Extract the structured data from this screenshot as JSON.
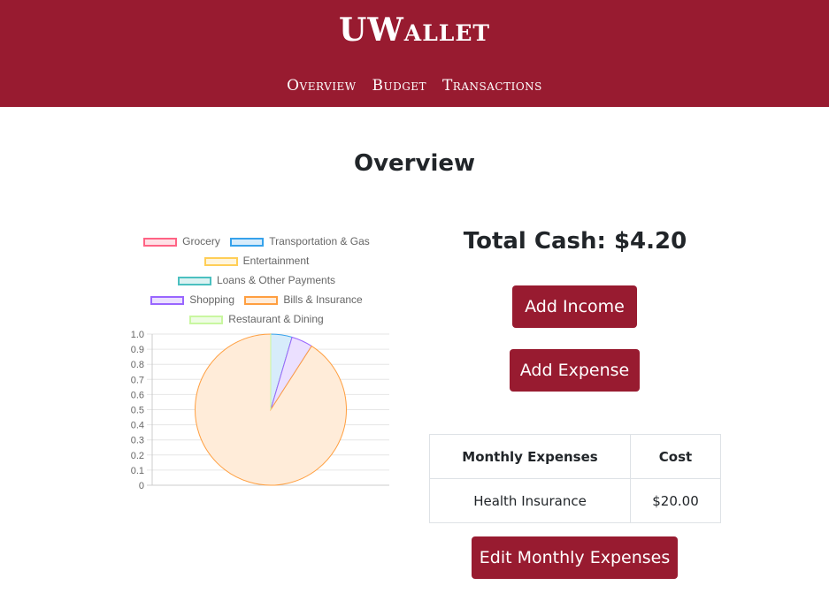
{
  "app": {
    "brand": "UWallet",
    "nav": [
      "Overview",
      "Budget",
      "Transactions"
    ]
  },
  "page": {
    "title": "Overview"
  },
  "chart_data": {
    "type": "pie",
    "legend_position": "top",
    "categories": [
      "Grocery",
      "Transportation & Gas",
      "Entertainment",
      "Loans & Other Payments",
      "Shopping",
      "Bills & Insurance",
      "Restaurant & Dining"
    ],
    "values": [
      0,
      1,
      0,
      0,
      1,
      20,
      0
    ],
    "colors": [
      "#ff6384",
      "#36a2eb",
      "#ffce56",
      "#4bc0c0",
      "#9966ff",
      "#ff9f40",
      "#c9f7a0"
    ],
    "fill_colors": [
      "#ffe0e6",
      "#d7ecfb",
      "#fff5dd",
      "#dbf2f2",
      "#ebe0ff",
      "#ffecd9",
      "#eefce3"
    ],
    "yticks": [
      "0",
      "0.1",
      "0.2",
      "0.3",
      "0.4",
      "0.5",
      "0.6",
      "0.7",
      "0.8",
      "0.9",
      "1.0"
    ],
    "ylim": [
      0,
      1.0
    ],
    "grid": true
  },
  "summary": {
    "total_cash": "Total Cash: $4.20",
    "add_income": "Add Income",
    "add_expense": "Add Expense"
  },
  "monthly_expenses": {
    "headers": [
      "Monthly Expenses",
      "Cost"
    ],
    "rows": [
      [
        "Health Insurance",
        "$20.00"
      ]
    ],
    "edit_button": "Edit Monthly Expenses"
  },
  "colors": {
    "brand": "#981b30",
    "text": "#212529"
  }
}
